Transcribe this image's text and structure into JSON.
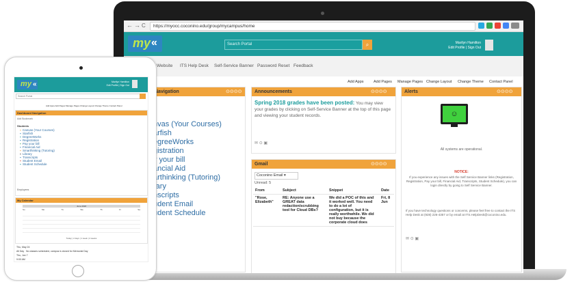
{
  "browser": {
    "url": "https://myocc.coconino.edu/group/mycampus/home",
    "back": "←",
    "forward": "→",
    "reload": "C",
    "colors": {
      "ext1": "#27a9e1",
      "ext2": "#34a853",
      "ext3": "#ea4335",
      "ext4": "#4285f4"
    }
  },
  "header": {
    "logo_text": "my",
    "logo_mark": "«",
    "search_placeholder": "Search Portal",
    "search_icon": "⌕",
    "user_name": "Marilyn Hamilton",
    "user_links": "Edit Profile | Sign Out",
    "colors": {
      "teal": "#1c9c9c",
      "orange": "#f0a33b",
      "logo_bg": "#2e86c1",
      "logo_text": "#bfe64b"
    }
  },
  "menu": {
    "items": [
      "Website",
      "ITS Help Desk",
      "Self-Service Banner",
      "Password Reset",
      "Feedback"
    ]
  },
  "actions": [
    "Add Apps",
    "Add Pages",
    "Manage Pages",
    "Change Layout",
    "Change Theme",
    "Contact Panel"
  ],
  "quick_nav": {
    "title": "Navigation",
    "controls": "⊙⊙⊙⊙",
    "items": [
      "nvas (Your Courses)",
      "arfish",
      "egreeWorks",
      "gistration",
      "y your bill",
      "ancial Aid",
      "arthinking (Tutoring)",
      "rary",
      "nscripts",
      "udent Email",
      "udent Schedule"
    ]
  },
  "announcements": {
    "title": "Announcements",
    "controls": "⊙⊙⊙⊙",
    "headline": "Spring 2018 grades have been posted:",
    "body": "You may view your grades by clicking on Self-Service Banner at the top of this page and viewing your student records."
  },
  "gmail": {
    "title": "Gmail",
    "controls": "⊙⊙⊙⊙",
    "account": "Coconino Email",
    "unread": "Unread: 5",
    "columns": [
      "From",
      "Subject",
      "Snippet",
      "Date"
    ],
    "rows": [
      {
        "from": "\"Rose, Elizabeth\"",
        "subject": "RE: Anyone use a GREAT data redaction/scrubbing tool for Cloud DBs?",
        "snippet": "We did a POC of this and it worked well. You need to do a lot of configuration, but it is really worthwhile. We did not buy because the corporate cloud does",
        "date": "Fri, 8 Jun"
      }
    ]
  },
  "alerts": {
    "title": "Alerts",
    "controls": "⊙⊙⊙⊙",
    "monitor_face": "☺",
    "status": "All systems are operational.",
    "notice_label": "NOTICE:",
    "notice_text": "If you experience any issues with the Self Service Banner links (Registration, Registration, Pay your bill, Financial Aid, Transcripts, Student Schedule), you can login directly by going to Self Service Banner.",
    "help_text": "If you have technology questions or concerns, please feel free to contact the ITS Help Desk at (928) 226-4357 or by email at ITS.HelpDesk@coconino.edu.",
    "colors": {
      "monitor_screen": "#40d13e",
      "notice": "#d63b2b"
    }
  },
  "tablet": {
    "user_name": "Marilyn Hamilton",
    "user_links": "Edit Profile | Sign Out",
    "search_placeholder": "Search Portal",
    "actions": "Add Apps  Add Pages  Manage Pages  Change Layout  Change Theme  Contact Panel",
    "quick_nav_title": "Dashboard Navigation",
    "quick_nav_sub": "Add Bookmark",
    "quick_nav_section": "Students",
    "quick_links": [
      "Canvas (Your Courses)",
      "Starfish",
      "DegreeWorks",
      "Registration",
      "Pay your bill",
      "Financial Aid",
      "Smarthinking (Tutoring)",
      "Library",
      "Transcripts",
      "Student Email",
      "Student Schedule"
    ],
    "quick_links_footer": "Employees",
    "calendar_title": "My Calendar",
    "calendar_month": "June 2018",
    "calendar_days": [
      "Su",
      "Mo",
      "Tu",
      "We",
      "Th",
      "Fr",
      "Sa"
    ],
    "calendar_footer": "Today | 2 days | 1 week | 4 weeks",
    "events": [
      {
        "date": "Thu, May 24",
        "time": "All Day",
        "text": "No classes scheduled, campus is closed for Memorial Day"
      },
      {
        "date": "Thu, Jun 7",
        "time": "9:00 AM",
        "text": ""
      }
    ]
  }
}
